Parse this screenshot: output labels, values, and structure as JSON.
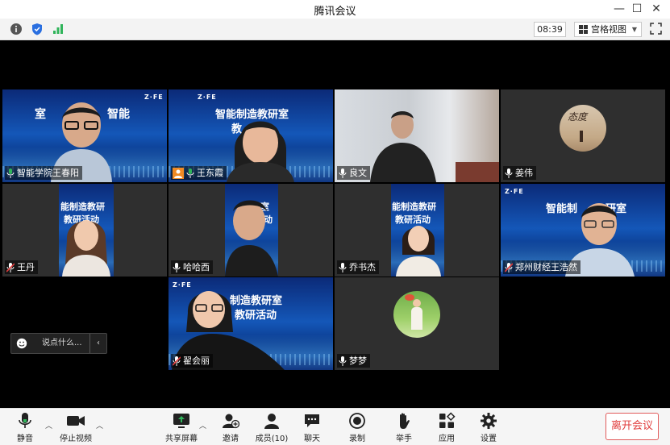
{
  "window": {
    "title": "腾讯会议"
  },
  "toolbar": {
    "meeting_time": "08:39",
    "view_mode": "宫格视图",
    "icons": [
      "info-icon",
      "shield-icon",
      "signal-icon",
      "grid-icon",
      "fullscreen-icon"
    ]
  },
  "participants": [
    {
      "name": "智能学院王春阳",
      "banner": "智能",
      "mic": "on",
      "speaking": true
    },
    {
      "name": "王东霞",
      "banner": "智能制造教研室",
      "banner2": "教",
      "mic": "on",
      "host_badge": true
    },
    {
      "name": "良文",
      "mic": "on"
    },
    {
      "name": "姜伟",
      "mic": "on",
      "avatar_text": "态度"
    },
    {
      "name": "王丹",
      "banner": "能制造教研",
      "banner2": "教研活动",
      "mic": "muted"
    },
    {
      "name": "哈哈西",
      "banner": "教研室",
      "banner2": "研活动",
      "mic": "on"
    },
    {
      "name": "乔书杰",
      "banner": "能制造教研",
      "banner2": "教研活动",
      "mic": "on"
    },
    {
      "name": "郑州财经王浩然",
      "banner": "智能制",
      "banner2": "研室",
      "mic": "muted"
    },
    {
      "name": "翟会丽",
      "banner": "制造教研室",
      "banner2": "教研活动",
      "mic": "muted"
    },
    {
      "name": "梦梦",
      "mic": "on"
    }
  ],
  "logo": "Z·FE",
  "chat": {
    "placeholder": "说点什么..."
  },
  "bottombar": {
    "mute": "静音",
    "stop_video": "停止视频",
    "share_screen": "共享屏幕",
    "invite": "邀请",
    "members": "成员(10)",
    "chat": "聊天",
    "record": "录制",
    "raise_hand": "举手",
    "apps": "应用",
    "settings": "设置",
    "leave": "离开会议"
  },
  "colors": {
    "speaking_border": "#2fb45a",
    "leave_red": "#e03c3c",
    "banner_blue": "#1457b8"
  }
}
